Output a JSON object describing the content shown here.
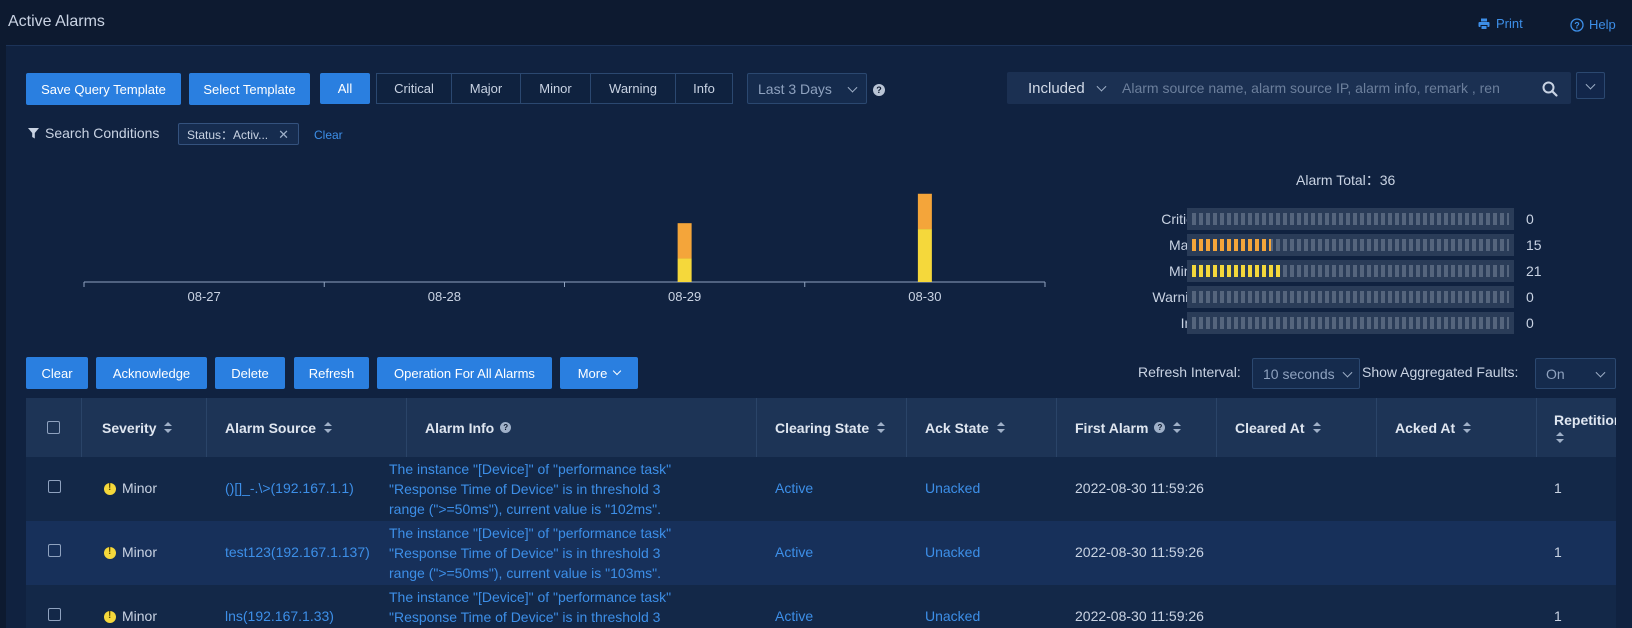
{
  "header": {
    "title": "Active Alarms",
    "print_label": "Print",
    "help_label": "Help"
  },
  "toolbar": {
    "save_template": "Save Query Template",
    "select_template": "Select Template",
    "severity_filters": [
      "All",
      "Critical",
      "Major",
      "Minor",
      "Warning",
      "Info"
    ],
    "time_range": "Last 3 Days"
  },
  "search": {
    "mode": "Included",
    "placeholder": "Alarm source name, alarm source IP, alarm info, remark , ren"
  },
  "conditions": {
    "label": "Search Conditions",
    "tag": "Status：Activ...",
    "clear": "Clear"
  },
  "colors": {
    "accent": "#2a7fe0",
    "major": "#f4a53a",
    "minor": "#f5d83b",
    "link": "#3d8fe8"
  },
  "chart_data": {
    "type": "bar",
    "stacked": true,
    "categories": [
      "08-27",
      "08-28",
      "08-29",
      "08-30"
    ],
    "series": [
      {
        "name": "Minor",
        "color": "#f5d83b",
        "values": [
          0,
          0,
          4,
          9
        ]
      },
      {
        "name": "Major",
        "color": "#f4a53a",
        "values": [
          0,
          0,
          6,
          6
        ]
      }
    ],
    "ylim": [
      0,
      17
    ]
  },
  "stats": {
    "total_label": "Alarm Total：36",
    "max_segments": 100,
    "rows": [
      {
        "label": "Critical",
        "value": "0",
        "fraction": 0.0,
        "color": "#e04d4d"
      },
      {
        "label": "Major",
        "value": "15",
        "fraction": 0.25,
        "color": "#f4a53a"
      },
      {
        "label": "Minor",
        "value": "21",
        "fraction": 0.28,
        "color": "#f5d83b"
      },
      {
        "label": "Warning",
        "value": "0",
        "fraction": 0.0,
        "color": "#4ea3f0"
      },
      {
        "label": "Info",
        "value": "0",
        "fraction": 0.0,
        "color": "#5fb0e0"
      }
    ]
  },
  "actions": {
    "clear": "Clear",
    "acknowledge": "Acknowledge",
    "delete": "Delete",
    "refresh": "Refresh",
    "operation_all": "Operation For All Alarms",
    "more": "More"
  },
  "refresh": {
    "interval_label": "Refresh Interval:",
    "interval_value": "10 seconds",
    "agg_label": "Show Aggregated Faults:",
    "agg_value": "On"
  },
  "table": {
    "columns": {
      "severity": "Severity",
      "source": "Alarm Source",
      "info": "Alarm Info",
      "clearing": "Clearing State",
      "ack": "Ack State",
      "first": "First Alarm",
      "cleared": "Cleared At",
      "acked": "Acked At",
      "repetitions": "Repetitions"
    },
    "rows": [
      {
        "severity": "Minor",
        "source": "()[]_-.\\>(192.167.1.1)",
        "info": "The instance \"[Device]\" of \"performance task\" \"Response Time of Device\" is in threshold 3 range (\">=50ms\"), current value is \"102ms\".",
        "clearing": "Active",
        "ack": "Unacked",
        "first": "2022-08-30 11:59:26",
        "cleared": "",
        "acked": "",
        "repetitions": "1"
      },
      {
        "severity": "Minor",
        "source": "test123(192.167.1.137)",
        "info": "The instance \"[Device]\" of \"performance task\" \"Response Time of Device\" is in threshold 3 range (\">=50ms\"), current value is \"103ms\".",
        "clearing": "Active",
        "ack": "Unacked",
        "first": "2022-08-30 11:59:26",
        "cleared": "",
        "acked": "",
        "repetitions": "1"
      },
      {
        "severity": "Minor",
        "source": "lns(192.167.1.33)",
        "info": "The instance \"[Device]\" of \"performance task\" \"Response Time of Device\" is in threshold 3",
        "clearing": "Active",
        "ack": "Unacked",
        "first": "2022-08-30 11:59:26",
        "cleared": "",
        "acked": "",
        "repetitions": "1"
      }
    ]
  }
}
